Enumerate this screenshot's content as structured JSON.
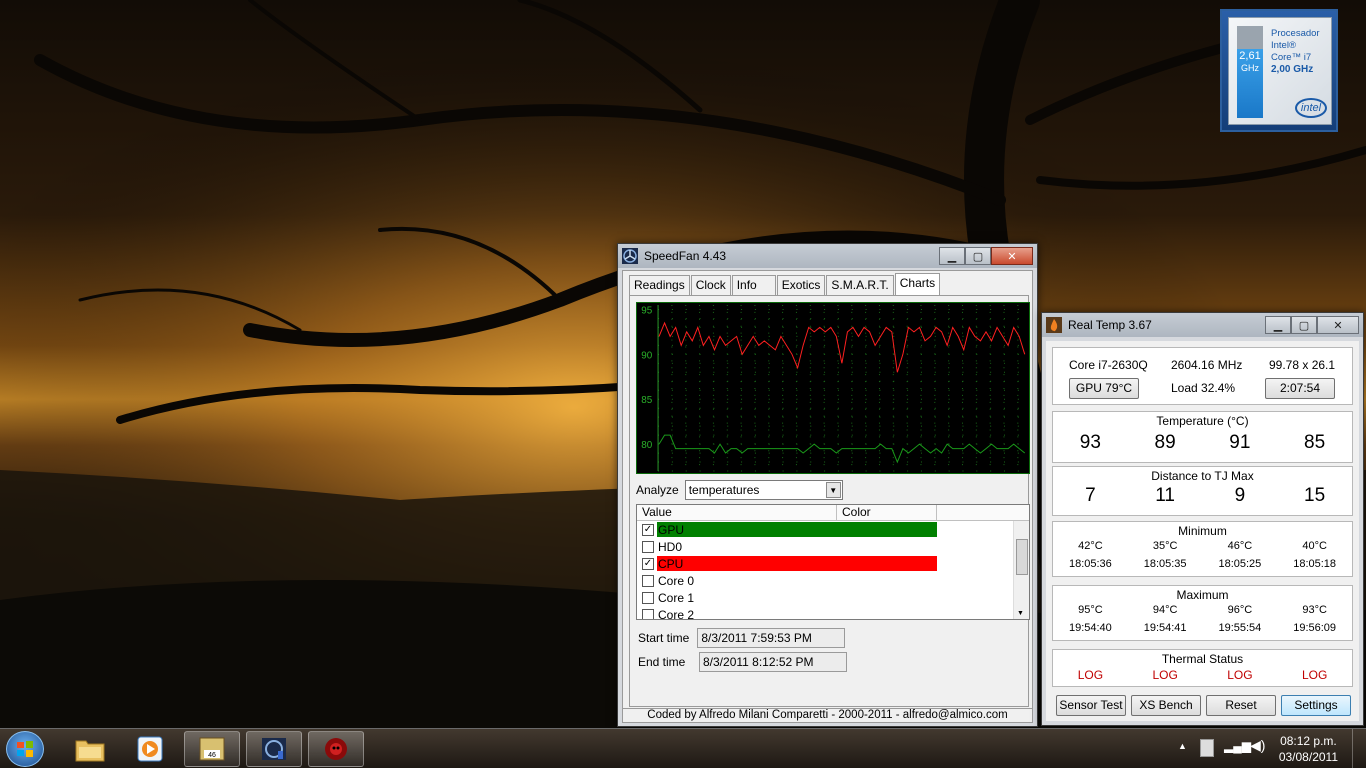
{
  "speedfan": {
    "title": "SpeedFan 4.43",
    "tabs": [
      "Readings",
      "Clock",
      "Info",
      "Exotics",
      "S.M.A.R.T.",
      "Charts"
    ],
    "active_tab": "Charts",
    "chart_ticks": [
      "95",
      "90",
      "85",
      "80"
    ],
    "analyze_label": "Analyze",
    "analyze_value": "temperatures",
    "list_headers": {
      "value": "Value",
      "color": "Color"
    },
    "list_items": [
      {
        "label": "GPU",
        "checked": true,
        "color": "#008000"
      },
      {
        "label": "HD0",
        "checked": false,
        "color": ""
      },
      {
        "label": "CPU",
        "checked": true,
        "color": "#ff0000"
      },
      {
        "label": "Core 0",
        "checked": false,
        "color": ""
      },
      {
        "label": "Core 1",
        "checked": false,
        "color": ""
      },
      {
        "label": "Core 2",
        "checked": false,
        "color": ""
      }
    ],
    "start_label": "Start time",
    "start_value": "8/3/2011 7:59:53 PM",
    "end_label": "End time",
    "end_value": "8/3/2011 8:12:52 PM",
    "status": "Coded by Alfredo Milani Comparetti - 2000-2011 - alfredo@almico.com"
  },
  "realtemp": {
    "title": "Real Temp 3.67",
    "cpu": "Core i7-2630Q",
    "mhz": "2604.16 MHz",
    "multiplier": "99.78 x 26.1",
    "gpu_button": "GPU  79°C",
    "load": "Load  32.4%",
    "timer_button": "2:07:54",
    "temp_title": "Temperature (°C)",
    "temps": [
      "93",
      "89",
      "91",
      "85"
    ],
    "tj_title": "Distance to TJ Max",
    "tj": [
      "7",
      "11",
      "9",
      "15"
    ],
    "min_title": "Minimum",
    "min_temps": [
      "42°C",
      "35°C",
      "46°C",
      "40°C"
    ],
    "min_times": [
      "18:05:36",
      "18:05:35",
      "18:05:25",
      "18:05:18"
    ],
    "max_title": "Maximum",
    "max_temps": [
      "95°C",
      "94°C",
      "96°C",
      "93°C"
    ],
    "max_times": [
      "19:54:40",
      "19:54:41",
      "19:55:54",
      "19:56:09"
    ],
    "thermal_title": "Thermal Status",
    "thermal": [
      "LOG",
      "LOG",
      "LOG",
      "LOG"
    ],
    "buttons": {
      "sensor": "Sensor Test",
      "xs": "XS Bench",
      "reset": "Reset",
      "settings": "Settings"
    }
  },
  "intel_gadget": {
    "freq": "2,61",
    "unit": "GHz",
    "line1": "Procesador",
    "line2": "Intel®",
    "line3": "Core™ i7",
    "base": "2,00 GHz",
    "logo": "intel",
    "fill_fraction": 0.75
  },
  "taskbar": {
    "time": "08:12 p.m.",
    "date": "03/08/2011"
  },
  "chart_data": {
    "type": "line",
    "ylim": [
      77,
      95.5
    ],
    "yticks": [
      95,
      90,
      85,
      80
    ],
    "series": [
      {
        "name": "CPU",
        "color": "#ff2020",
        "values": [
          92,
          93.5,
          92,
          93,
          91,
          92.5,
          91.5,
          93,
          91,
          92,
          90.5,
          92,
          91,
          91.5,
          92,
          90,
          91,
          92,
          91,
          91.5,
          91,
          90.5,
          92,
          91,
          90,
          88.5,
          91,
          93,
          92.5,
          93,
          92.5,
          93,
          92,
          89,
          92.5,
          93,
          92,
          93,
          92.5,
          91,
          92,
          93,
          92.5,
          88,
          90,
          93,
          92.5,
          93,
          91.5,
          92,
          93,
          92.5,
          91,
          93,
          92,
          90.5,
          93,
          92,
          91.5,
          92.5,
          91.5,
          93,
          92,
          91,
          93,
          92,
          90
        ]
      },
      {
        "name": "GPU",
        "color": "#1a9a1a",
        "values": [
          80,
          81,
          81,
          79.5,
          79.5,
          79.5,
          79.5,
          79.5,
          79.5,
          79.5,
          79,
          80,
          79,
          79.5,
          79.5,
          79,
          79.5,
          79.5,
          79.5,
          79.5,
          79.5,
          79.5,
          79.5,
          79.5,
          79.5,
          79.5,
          79,
          79.5,
          80,
          79.5,
          79.5,
          79.5,
          79,
          79.5,
          79.5,
          79.5,
          79.5,
          79.5,
          79.5,
          79.5,
          80,
          79.5,
          79.5,
          78,
          79.5,
          79,
          79.5,
          80,
          79.5,
          79,
          79.5,
          79,
          80,
          79.5,
          79.5,
          79.5,
          80,
          79.5,
          79,
          79.5,
          80,
          79.5,
          79.5,
          79.5,
          80,
          79.5,
          79
        ]
      }
    ]
  }
}
